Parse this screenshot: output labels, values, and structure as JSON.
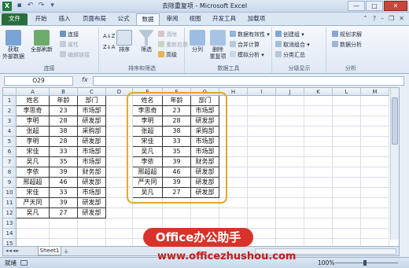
{
  "window": {
    "title": "去除重复项 - Microsoft Excel",
    "app_icon": "X",
    "minimize": "—",
    "maximize": "□",
    "close": "✕"
  },
  "tabs": [
    "文件",
    "开始",
    "插入",
    "页面布局",
    "公式",
    "数据",
    "审阅",
    "视图",
    "开发工具",
    "加载项"
  ],
  "active_tab": "数据",
  "ribbon": {
    "get_external_label": "获取\n外部数据",
    "refresh_label": "全部刷新",
    "connections": "连接",
    "properties": "属性",
    "edit_links": "编辑链接",
    "group_connections": "连接",
    "sort_label": "排序",
    "filter_label": "筛选",
    "clear": "清除",
    "reapply": "重新应用",
    "advanced": "高级",
    "group_sort_filter": "排序和筛选",
    "text_to_columns": "分列",
    "remove_duplicates": "删除\n重复项",
    "data_validation": "数据有效性",
    "consolidate": "合并计算",
    "what_if": "模拟分析",
    "group_data_tools": "数据工具",
    "group_create": "创建组",
    "ungroup": "取消组合",
    "subtotal": "分类汇总",
    "group_outline": "分级显示",
    "solver": "规划求解",
    "data_analysis": "数据分析",
    "group_analysis": "分析"
  },
  "formula_bar": {
    "name_box": "O29",
    "fx": "fx",
    "value": ""
  },
  "columns": [
    "A",
    "B",
    "C",
    "D",
    "E",
    "F",
    "G",
    "H",
    "I",
    "J",
    "K",
    "L",
    "M"
  ],
  "rows": [
    "1",
    "2",
    "3",
    "4",
    "5",
    "6",
    "7",
    "8",
    "9",
    "10",
    "11",
    "12",
    "13",
    "14",
    "15"
  ],
  "table_left": {
    "headers": [
      "姓名",
      "年龄",
      "部门"
    ],
    "rows": [
      [
        "李思奇",
        "23",
        "市场部"
      ],
      [
        "李明",
        "28",
        "研发部"
      ],
      [
        "张超",
        "38",
        "采购部"
      ],
      [
        "李明",
        "28",
        "研发部"
      ],
      [
        "宋佳",
        "33",
        "市场部"
      ],
      [
        "吴凡",
        "35",
        "市场部"
      ],
      [
        "李依",
        "39",
        "财务部"
      ],
      [
        "邢超超",
        "46",
        "研发部"
      ],
      [
        "宋佳",
        "33",
        "市场部"
      ],
      [
        "严天同",
        "39",
        "研发部"
      ],
      [
        "吴凡",
        "27",
        "研发部"
      ]
    ]
  },
  "table_right": {
    "headers": [
      "姓名",
      "年龄",
      "部门"
    ],
    "rows": [
      [
        "李思奇",
        "23",
        "市场部"
      ],
      [
        "李明",
        "28",
        "研发部"
      ],
      [
        "张超",
        "38",
        "采购部"
      ],
      [
        "宋佳",
        "33",
        "市场部"
      ],
      [
        "吴凡",
        "35",
        "市场部"
      ],
      [
        "李依",
        "39",
        "财务部"
      ],
      [
        "邢超超",
        "46",
        "研发部"
      ],
      [
        "严天同",
        "39",
        "研发部"
      ],
      [
        "吴凡",
        "27",
        "研发部"
      ]
    ]
  },
  "sheet_tab": "Sheet1",
  "status": {
    "ready": "就绪",
    "zoom": "100%"
  },
  "watermark": {
    "badge": "Office办公助手",
    "url": "www.officezhushou.com"
  },
  "colors": {
    "file_tab": "#2a6f3b",
    "highlight_box": "#e4a52e",
    "watermark_red": "#d8322b"
  }
}
